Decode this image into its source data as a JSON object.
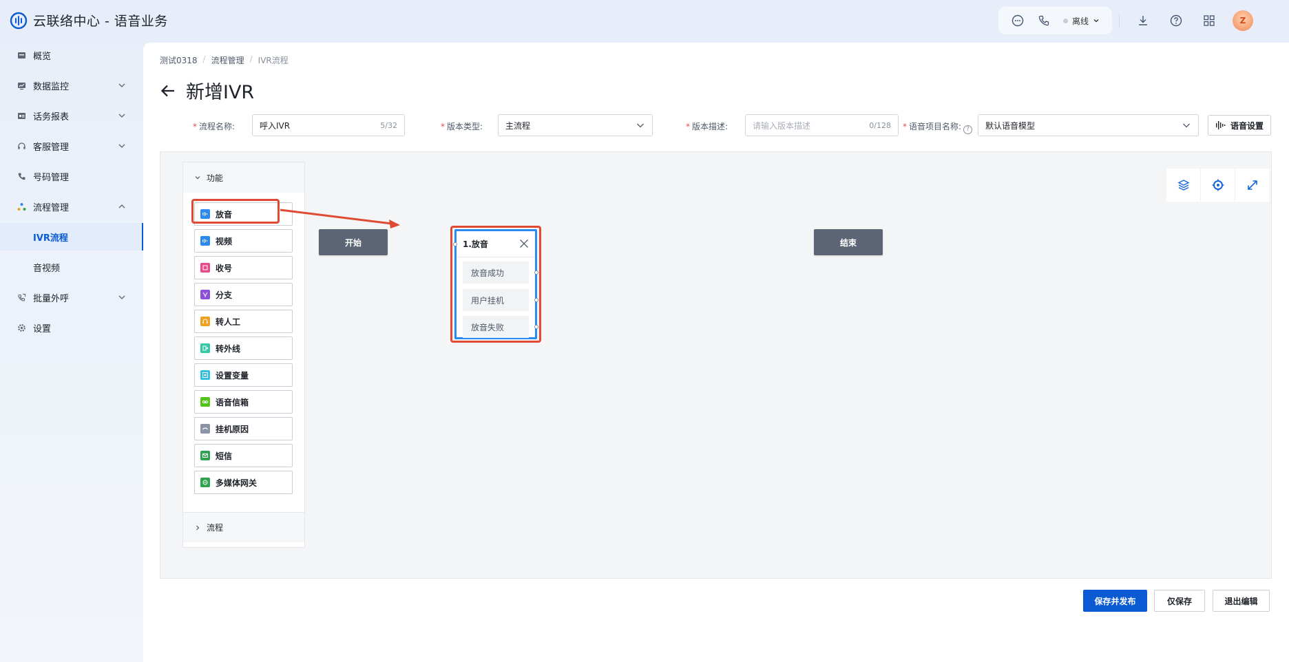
{
  "app": {
    "title": "云联络中心 - 语音业务",
    "status_label": "离线",
    "avatar_label": "Z"
  },
  "sidebar": {
    "items": [
      {
        "label": "概览",
        "icon": "overview-icon"
      },
      {
        "label": "数据监控",
        "icon": "monitor-icon",
        "expandable": true
      },
      {
        "label": "话务报表",
        "icon": "report-icon",
        "expandable": true
      },
      {
        "label": "客服管理",
        "icon": "headset-icon",
        "expandable": true
      },
      {
        "label": "号码管理",
        "icon": "phone-icon"
      },
      {
        "label": "流程管理",
        "icon": "flow-icon",
        "expanded": true
      },
      {
        "label": "IVR流程",
        "active": true
      },
      {
        "label": "音视频"
      },
      {
        "label": "批量外呼",
        "icon": "outbound-icon",
        "expandable": true
      },
      {
        "label": "设置",
        "icon": "settings-icon"
      }
    ]
  },
  "breadcrumb": [
    "测试0318",
    "流程管理",
    "IVR流程"
  ],
  "page": {
    "title": "新增IVR"
  },
  "form": {
    "flow_name_label": "流程名称:",
    "flow_name_value": "呼入IVR",
    "flow_name_count": "5/32",
    "version_type_label": "版本类型:",
    "version_type_value": "主流程",
    "version_desc_label": "版本描述:",
    "version_desc_placeholder": "请输入版本描述",
    "version_desc_count": "0/128",
    "voice_project_label": "语音项目名称:",
    "voice_project_value": "默认语音模型",
    "voice_settings_button": "语音设置"
  },
  "palette": {
    "section_function": "功能",
    "section_flow": "流程",
    "items": [
      {
        "label": "放音",
        "color": "#2a8af0",
        "icon": "audio-wave-icon"
      },
      {
        "label": "视频",
        "color": "#2a8af0",
        "icon": "video-icon"
      },
      {
        "label": "收号",
        "color": "#e84b8a",
        "icon": "keypad-icon"
      },
      {
        "label": "分支",
        "color": "#8c4fd8",
        "icon": "branch-icon"
      },
      {
        "label": "转人工",
        "color": "#f0a020",
        "icon": "agent-icon"
      },
      {
        "label": "转外线",
        "color": "#36c7a4",
        "icon": "external-line-icon"
      },
      {
        "label": "设置变量",
        "color": "#33bfe0",
        "icon": "variable-icon"
      },
      {
        "label": "语音信箱",
        "color": "#52c41a",
        "icon": "voicemail-icon"
      },
      {
        "label": "挂机原因",
        "color": "#8a94a6",
        "icon": "hangup-icon"
      },
      {
        "label": "短信",
        "color": "#2fa34f",
        "icon": "sms-icon"
      },
      {
        "label": "多媒体网关",
        "color": "#2fa34f",
        "icon": "gateway-icon"
      }
    ]
  },
  "canvas": {
    "start_label": "开始",
    "end_label": "结束",
    "play_node": {
      "title": "1.放音",
      "branches": [
        "放音成功",
        "用户挂机",
        "放音失败"
      ]
    },
    "tools": [
      "layers-icon",
      "locate-icon",
      "fullscreen-icon"
    ]
  },
  "footer": {
    "save_publish": "保存并发布",
    "save_only": "仅保存",
    "exit_edit": "退出编辑"
  },
  "colors": {
    "primary": "#0a5bd3",
    "highlight": "#e04a33",
    "node_gray": "#5c6575",
    "node_border": "#2a8af0"
  }
}
